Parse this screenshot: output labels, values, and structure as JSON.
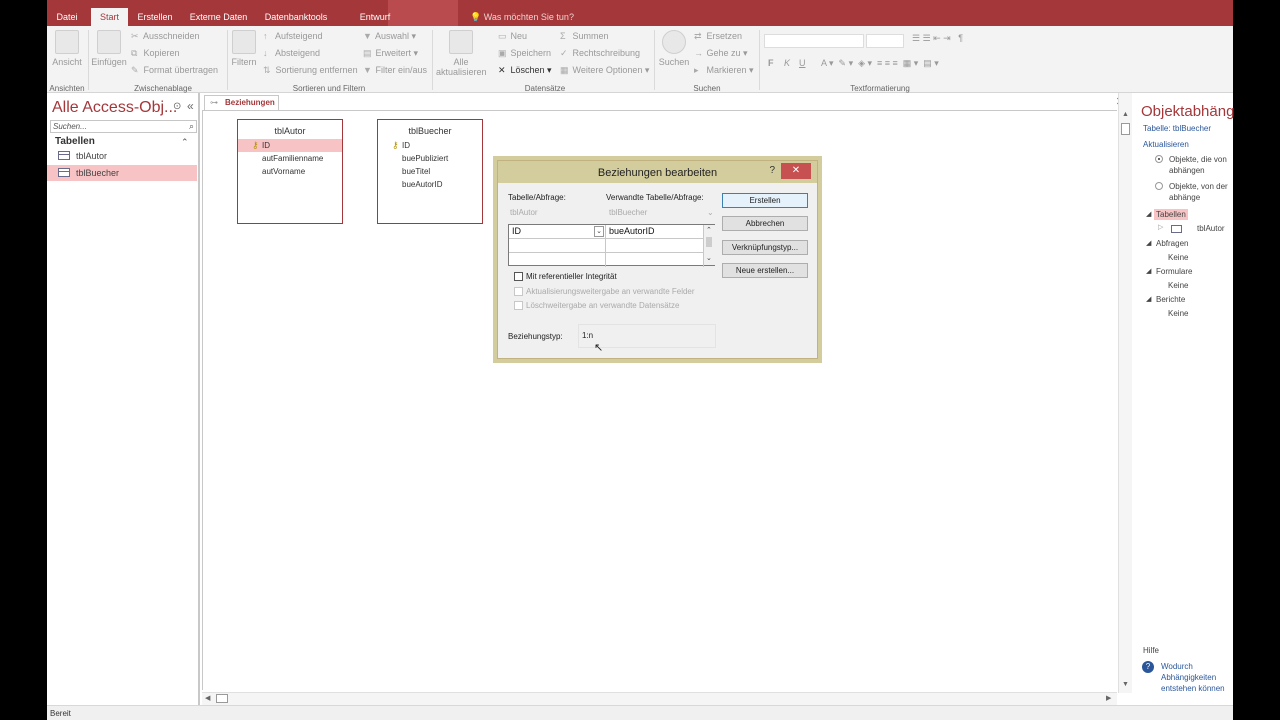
{
  "ribbon_tabs": [
    "Datei",
    "Start",
    "Erstellen",
    "Externe Daten",
    "Datenbanktools",
    "Entwurf"
  ],
  "tell_me": "Was möchten Sie tun?",
  "ribbon": {
    "ansicht": "Ansicht",
    "einfuegen": "Einfügen",
    "ausschneiden": "Ausschneiden",
    "kopieren": "Kopieren",
    "format": "Format übertragen",
    "filtern": "Filtern",
    "aufsteigend": "Aufsteigend",
    "absteigend": "Absteigend",
    "sortierung": "Sortierung entfernen",
    "auswahl": "Auswahl",
    "erweitert": "Erweitert",
    "filter": "Filter ein/aus",
    "alle": "Alle",
    "aktualisieren": "aktualisieren",
    "neu": "Neu",
    "speichern": "Speichern",
    "loeschen": "Löschen",
    "summen": "Summen",
    "rechtschreibung": "Rechtschreibung",
    "weitere": "Weitere Optionen",
    "suchen": "Suchen",
    "ersetzen": "Ersetzen",
    "gehe": "Gehe zu",
    "markieren": "Markieren",
    "groups": [
      "Ansichten",
      "Zwischenablage",
      "Sortieren und Filtern",
      "Datensätze",
      "Suchen",
      "Textformatierung"
    ]
  },
  "nav": {
    "title": "Alle Access-Obj...",
    "search": "Suchen...",
    "section": "Tabellen",
    "items": [
      "tblAutor",
      "tblBuecher"
    ]
  },
  "doc_tab": "Beziehungen",
  "tables": [
    {
      "name": "tblAutor",
      "fields": [
        "ID",
        "autFamilienname",
        "autVorname"
      ]
    },
    {
      "name": "tblBuecher",
      "fields": [
        "ID",
        "buePubliziert",
        "bueTitel",
        "bueAutorID"
      ]
    }
  ],
  "dialog": {
    "title": "Beziehungen bearbeiten",
    "help": "?",
    "close": "✕",
    "lbl_table": "Tabelle/Abfrage:",
    "lbl_related": "Verwandte Tabelle/Abfrage:",
    "table": "tblAutor",
    "related": "tblBuecher",
    "field_left": "ID",
    "field_right": "bueAutorID",
    "chk_integrity": "Mit referentieller Integrität",
    "chk_update": "Aktualisierungsweitergabe an verwandte Felder",
    "chk_delete": "Löschweitergabe an verwandte Datensätze",
    "rel_type_label": "Beziehungstyp:",
    "rel_type": "1:n",
    "btn_create": "Erstellen",
    "btn_cancel": "Abbrechen",
    "btn_join": "Verknüpfungstyp...",
    "btn_new": "Neue erstellen..."
  },
  "dep": {
    "title": "Objektabhäng",
    "table": "Tabelle: tblBuecher",
    "refresh": "Aktualisieren",
    "opt1": [
      "Objekte, die von",
      "abhängen"
    ],
    "opt2": [
      "Objekte, von der",
      "abhänge"
    ],
    "tabellen": "Tabellen",
    "tblAutor": "tblAutor",
    "abfragen": "Abfragen",
    "formulare": "Formulare",
    "berichte": "Berichte",
    "keine": "Keine",
    "hilfe": "Hilfe",
    "wodurch": [
      "Wodurch",
      "Abhängigkeiten",
      "entstehen können"
    ]
  },
  "status": "Bereit",
  "colors": {
    "accent": "#a4373a",
    "selection": "#f7c3c4",
    "dialog_frame": "#d3cc9c"
  }
}
